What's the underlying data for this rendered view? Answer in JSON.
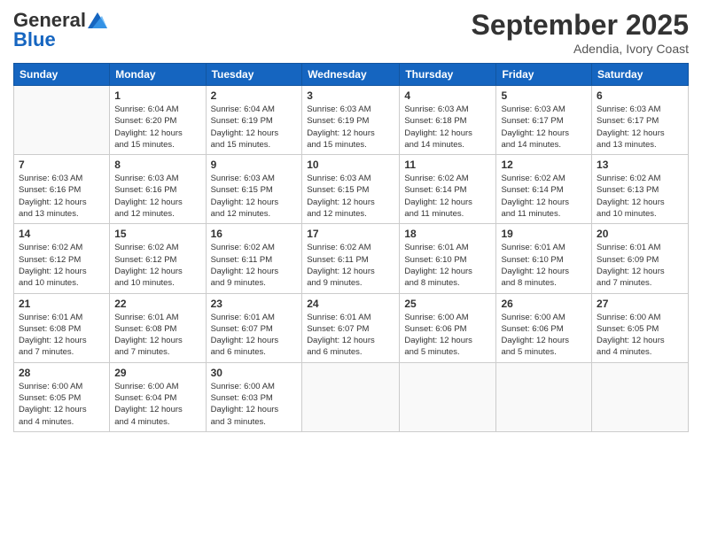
{
  "logo": {
    "general": "General",
    "blue": "Blue"
  },
  "header": {
    "month": "September 2025",
    "location": "Adendia, Ivory Coast"
  },
  "days_of_week": [
    "Sunday",
    "Monday",
    "Tuesday",
    "Wednesday",
    "Thursday",
    "Friday",
    "Saturday"
  ],
  "weeks": [
    [
      {
        "day": "",
        "info": ""
      },
      {
        "day": "1",
        "info": "Sunrise: 6:04 AM\nSunset: 6:20 PM\nDaylight: 12 hours\nand 15 minutes."
      },
      {
        "day": "2",
        "info": "Sunrise: 6:04 AM\nSunset: 6:19 PM\nDaylight: 12 hours\nand 15 minutes."
      },
      {
        "day": "3",
        "info": "Sunrise: 6:03 AM\nSunset: 6:19 PM\nDaylight: 12 hours\nand 15 minutes."
      },
      {
        "day": "4",
        "info": "Sunrise: 6:03 AM\nSunset: 6:18 PM\nDaylight: 12 hours\nand 14 minutes."
      },
      {
        "day": "5",
        "info": "Sunrise: 6:03 AM\nSunset: 6:17 PM\nDaylight: 12 hours\nand 14 minutes."
      },
      {
        "day": "6",
        "info": "Sunrise: 6:03 AM\nSunset: 6:17 PM\nDaylight: 12 hours\nand 13 minutes."
      }
    ],
    [
      {
        "day": "7",
        "info": "Sunrise: 6:03 AM\nSunset: 6:16 PM\nDaylight: 12 hours\nand 13 minutes."
      },
      {
        "day": "8",
        "info": "Sunrise: 6:03 AM\nSunset: 6:16 PM\nDaylight: 12 hours\nand 12 minutes."
      },
      {
        "day": "9",
        "info": "Sunrise: 6:03 AM\nSunset: 6:15 PM\nDaylight: 12 hours\nand 12 minutes."
      },
      {
        "day": "10",
        "info": "Sunrise: 6:03 AM\nSunset: 6:15 PM\nDaylight: 12 hours\nand 12 minutes."
      },
      {
        "day": "11",
        "info": "Sunrise: 6:02 AM\nSunset: 6:14 PM\nDaylight: 12 hours\nand 11 minutes."
      },
      {
        "day": "12",
        "info": "Sunrise: 6:02 AM\nSunset: 6:14 PM\nDaylight: 12 hours\nand 11 minutes."
      },
      {
        "day": "13",
        "info": "Sunrise: 6:02 AM\nSunset: 6:13 PM\nDaylight: 12 hours\nand 10 minutes."
      }
    ],
    [
      {
        "day": "14",
        "info": "Sunrise: 6:02 AM\nSunset: 6:12 PM\nDaylight: 12 hours\nand 10 minutes."
      },
      {
        "day": "15",
        "info": "Sunrise: 6:02 AM\nSunset: 6:12 PM\nDaylight: 12 hours\nand 10 minutes."
      },
      {
        "day": "16",
        "info": "Sunrise: 6:02 AM\nSunset: 6:11 PM\nDaylight: 12 hours\nand 9 minutes."
      },
      {
        "day": "17",
        "info": "Sunrise: 6:02 AM\nSunset: 6:11 PM\nDaylight: 12 hours\nand 9 minutes."
      },
      {
        "day": "18",
        "info": "Sunrise: 6:01 AM\nSunset: 6:10 PM\nDaylight: 12 hours\nand 8 minutes."
      },
      {
        "day": "19",
        "info": "Sunrise: 6:01 AM\nSunset: 6:10 PM\nDaylight: 12 hours\nand 8 minutes."
      },
      {
        "day": "20",
        "info": "Sunrise: 6:01 AM\nSunset: 6:09 PM\nDaylight: 12 hours\nand 7 minutes."
      }
    ],
    [
      {
        "day": "21",
        "info": "Sunrise: 6:01 AM\nSunset: 6:08 PM\nDaylight: 12 hours\nand 7 minutes."
      },
      {
        "day": "22",
        "info": "Sunrise: 6:01 AM\nSunset: 6:08 PM\nDaylight: 12 hours\nand 7 minutes."
      },
      {
        "day": "23",
        "info": "Sunrise: 6:01 AM\nSunset: 6:07 PM\nDaylight: 12 hours\nand 6 minutes."
      },
      {
        "day": "24",
        "info": "Sunrise: 6:01 AM\nSunset: 6:07 PM\nDaylight: 12 hours\nand 6 minutes."
      },
      {
        "day": "25",
        "info": "Sunrise: 6:00 AM\nSunset: 6:06 PM\nDaylight: 12 hours\nand 5 minutes."
      },
      {
        "day": "26",
        "info": "Sunrise: 6:00 AM\nSunset: 6:06 PM\nDaylight: 12 hours\nand 5 minutes."
      },
      {
        "day": "27",
        "info": "Sunrise: 6:00 AM\nSunset: 6:05 PM\nDaylight: 12 hours\nand 4 minutes."
      }
    ],
    [
      {
        "day": "28",
        "info": "Sunrise: 6:00 AM\nSunset: 6:05 PM\nDaylight: 12 hours\nand 4 minutes."
      },
      {
        "day": "29",
        "info": "Sunrise: 6:00 AM\nSunset: 6:04 PM\nDaylight: 12 hours\nand 4 minutes."
      },
      {
        "day": "30",
        "info": "Sunrise: 6:00 AM\nSunset: 6:03 PM\nDaylight: 12 hours\nand 3 minutes."
      },
      {
        "day": "",
        "info": ""
      },
      {
        "day": "",
        "info": ""
      },
      {
        "day": "",
        "info": ""
      },
      {
        "day": "",
        "info": ""
      }
    ]
  ]
}
